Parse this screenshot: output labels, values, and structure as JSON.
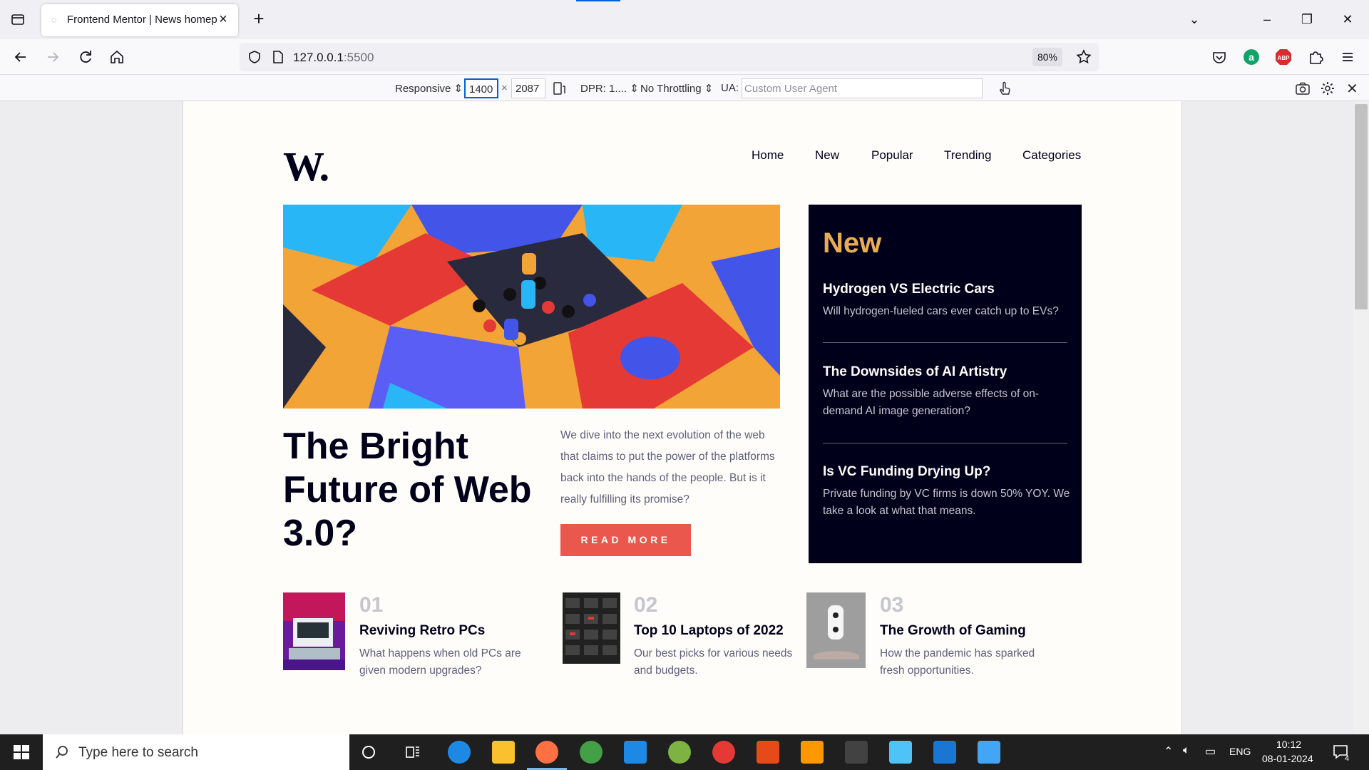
{
  "browser": {
    "tab_title": "Frontend Mentor | News homepage",
    "url_host": "127.0.0.1",
    "url_port": ":5500",
    "zoom": "80%"
  },
  "devtools": {
    "mode": "Responsive",
    "width": "1400",
    "height": "2087",
    "times_sign": "×",
    "dpr": "DPR: 1....",
    "throttling": "No Throttling",
    "ua_label": "UA:",
    "ua_placeholder": "Custom User Agent"
  },
  "site": {
    "logo": "W.",
    "nav": [
      "Home",
      "New",
      "Popular",
      "Trending",
      "Categories"
    ],
    "hero": {
      "title": "The Bright Future of Web 3.0?",
      "text": "We dive into the next evolution of the web that claims to put the power of the platforms back into the hands of the people. But is it really fulfilling its promise?",
      "button": "READ MORE"
    },
    "new": {
      "heading": "New",
      "items": [
        {
          "title": "Hydrogen VS Electric Cars",
          "text": "Will hydrogen-fueled cars ever catch up to EVs?"
        },
        {
          "title": "The Downsides of AI Artistry",
          "text": "What are the possible adverse effects of on-demand AI image generation?"
        },
        {
          "title": "Is VC Funding Drying Up?",
          "text": "Private funding by VC firms is down 50% YOY. We take a look at what that means."
        }
      ]
    },
    "cards": [
      {
        "num": "01",
        "title": "Reviving Retro PCs",
        "text": "What happens when old PCs are given modern upgrades?"
      },
      {
        "num": "02",
        "title": "Top 10 Laptops of 2022",
        "text": "Our best picks for various needs and budgets."
      },
      {
        "num": "03",
        "title": "The Growth of Gaming",
        "text": "How the pandemic has sparked fresh opportunities."
      }
    ]
  },
  "taskbar": {
    "search_placeholder": "Type here to search",
    "lang": "ENG",
    "time": "10:12",
    "date": "08-01-2024",
    "notifications": "4"
  },
  "colors": {
    "accent_red": "#e9574d",
    "accent_orange": "#e9ab53",
    "dark_blue": "#00001a"
  }
}
